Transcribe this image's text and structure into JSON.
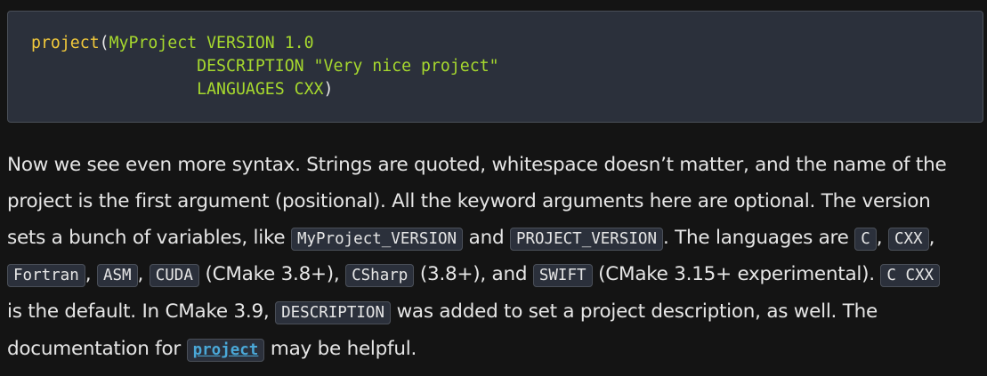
{
  "code": {
    "line1": {
      "fn": "project",
      "open": "(",
      "rest": "MyProject VERSION 1.0"
    },
    "line2": {
      "indent": "                 ",
      "text": "DESCRIPTION \"Very nice project\""
    },
    "line3": {
      "indent": "                 ",
      "text": "LANGUAGES CXX",
      "close": ")"
    }
  },
  "prose": {
    "l1": "Now we see even more syntax. Strings are quoted, whitespace doesn’t matter, and the name of the",
    "l2": "project is the first argument (positional). All the keyword arguments here are optional. The version",
    "l3a": "sets a bunch of variables, like ",
    "code_myproject_version": "MyProject_VERSION",
    "l3b": " and ",
    "code_project_version": "PROJECT_VERSION",
    "l3c": ". The languages are ",
    "code_c": "C",
    "sep_comma": ", ",
    "code_cxx": "CXX",
    "l3d": ",",
    "code_fortran": "Fortran",
    "code_asm": "ASM",
    "code_cuda": "CUDA",
    "l4a": " (CMake 3.8+), ",
    "code_csharp": "CSharp",
    "l4b": " (3.8+), and ",
    "code_swift": "SWIFT",
    "l4c": " (CMake 3.15+ experimental). ",
    "code_c_cxx": "C CXX",
    "l5a": "is the default. In CMake 3.9, ",
    "code_description": "DESCRIPTION",
    "l5b": " was added to set a project description, as well. The",
    "l6a": "documentation for ",
    "link_project": "project",
    "l6b": " may be helpful."
  }
}
